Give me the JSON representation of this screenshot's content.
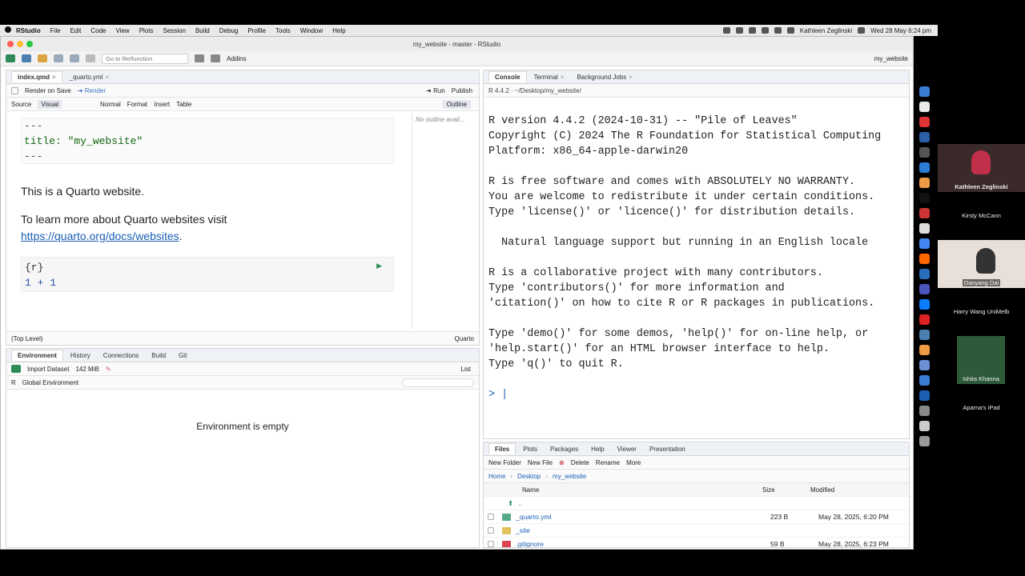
{
  "menubar": {
    "app": "RStudio",
    "items": [
      "File",
      "Edit",
      "Code",
      "View",
      "Plots",
      "Session",
      "Build",
      "Debug",
      "Profile",
      "Tools",
      "Window",
      "Help"
    ],
    "user": "Kathleen Zeglinski",
    "datetime": "Wed 28 May  6:24 pm"
  },
  "window": {
    "title": "my_website - master - RStudio"
  },
  "toolbar": {
    "goto_placeholder": "Go to file/function",
    "addins": "Addins",
    "project": "my_website"
  },
  "editor": {
    "tabs": [
      "index.qmd",
      "_quarto.yml"
    ],
    "render_on_save": "Render on Save",
    "render": "Render",
    "run": "Run",
    "publish": "Publish",
    "modes": [
      "Source",
      "Visual"
    ],
    "normal": "Normal",
    "format": "Format",
    "insert": "Insert",
    "table": "Table",
    "outline": "Outline",
    "outline_empty": "No outline avail...",
    "yaml_lines": [
      "---",
      "title: \"my_website\"",
      "---"
    ],
    "para1": "This is a Quarto website.",
    "para2": "To learn more about Quarto websites visit",
    "link": "https://quarto.org/docs/websites",
    "link_suffix": ".",
    "chunk_header": "{r}",
    "chunk_code": "1 + 1",
    "status_left": "(Top Level)",
    "status_right": "Quarto"
  },
  "env": {
    "tabs": [
      "Environment",
      "History",
      "Connections",
      "Build",
      "Git"
    ],
    "import": "Import Dataset",
    "memory": "142 MiB",
    "list": "List",
    "r_label": "R",
    "global": "Global Environment",
    "empty": "Environment is empty"
  },
  "console": {
    "tabs": [
      "Console",
      "Terminal",
      "Background Jobs"
    ],
    "path": "R 4.4.2 · ~/Desktop/my_website/",
    "lines": [
      "R version 4.4.2 (2024-10-31) -- \"Pile of Leaves\"",
      "Copyright (C) 2024 The R Foundation for Statistical Computing",
      "Platform: x86_64-apple-darwin20",
      "",
      "R is free software and comes with ABSOLUTELY NO WARRANTY.",
      "You are welcome to redistribute it under certain conditions.",
      "Type 'license()' or 'licence()' for distribution details.",
      "",
      "  Natural language support but running in an English locale",
      "",
      "R is a collaborative project with many contributors.",
      "Type 'contributors()' for more information and",
      "'citation()' on how to cite R or R packages in publications.",
      "",
      "Type 'demo()' for some demos, 'help()' for on-line help, or",
      "'help.start()' for an HTML browser interface to help.",
      "Type 'q()' to quit R."
    ],
    "prompt": ">"
  },
  "files": {
    "tabs": [
      "Files",
      "Plots",
      "Packages",
      "Help",
      "Viewer",
      "Presentation"
    ],
    "actions": [
      "New Folder",
      "New File",
      "Delete",
      "Rename",
      "More"
    ],
    "breadcrumb": [
      "Home",
      "Desktop",
      "my_website"
    ],
    "columns": [
      "Name",
      "Size",
      "Modified"
    ],
    "rows": [
      {
        "name": "..",
        "size": "",
        "modified": ""
      },
      {
        "name": "_quarto.yml",
        "size": "223 B",
        "modified": "May 28, 2025, 6:20 PM"
      },
      {
        "name": "_site",
        "size": "",
        "modified": ""
      },
      {
        "name": ".gitignore",
        "size": "59 B",
        "modified": "May 28, 2025, 6:23 PM"
      }
    ]
  },
  "participants": [
    "Kathleen Zeglinski",
    "Kirsty McCann",
    "Danyang Dai",
    "Harry Wang UniMelb",
    "Ishita Khanna",
    "Aparna's iPad"
  ]
}
